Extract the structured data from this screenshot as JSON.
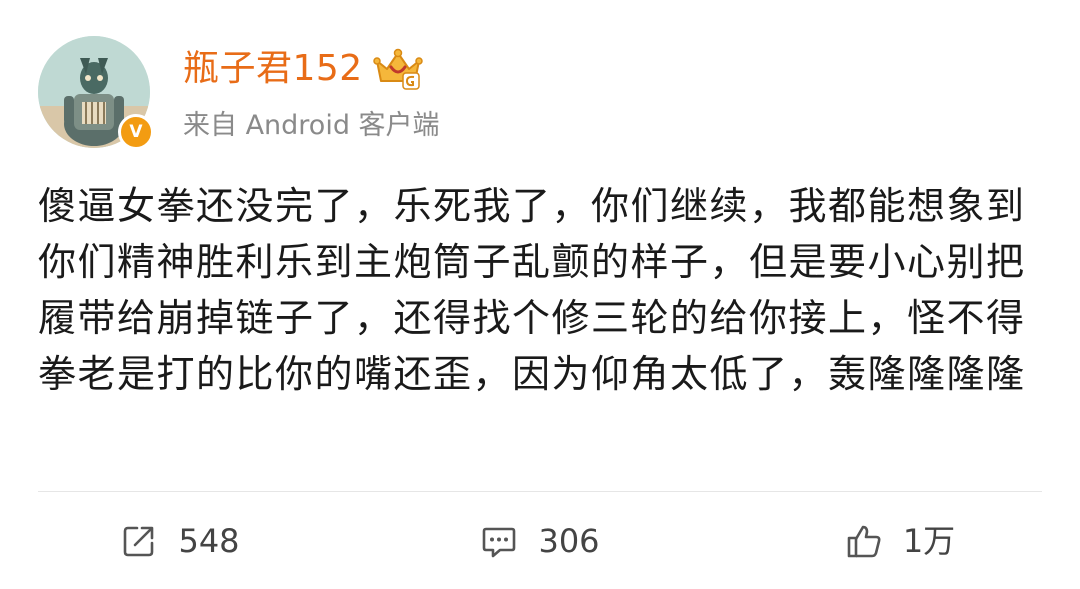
{
  "post": {
    "author": {
      "name": "瓶子君152",
      "source": "来自 Android 客户端",
      "verified_badge": "V"
    },
    "text": "傻逼女拳还没完了，乐死我了，你们继续，我都能想象到你们精神胜利乐到主炮筒子乱颤的样子，但是要小心别把履带给崩掉链子了，还得找个修三轮的给你接上，怪不得拳老是打的比你的嘴还歪，因为仰角太低了，轰隆隆隆隆",
    "actions": {
      "repost_count": "548",
      "comment_count": "306",
      "like_count": "1万"
    }
  },
  "icons": {
    "avatar": "avatar-illustration",
    "verified": "verified-v-icon",
    "vip": "crown-vip-icon",
    "repost": "share-icon",
    "comment": "comment-icon",
    "like": "thumbs-up-icon"
  },
  "colors": {
    "username": "#e86c17",
    "source": "#8a8a8a",
    "badge": "#f39c12",
    "text": "#1a1a1a",
    "divider": "#e6e6e6",
    "action_text": "#444444"
  }
}
